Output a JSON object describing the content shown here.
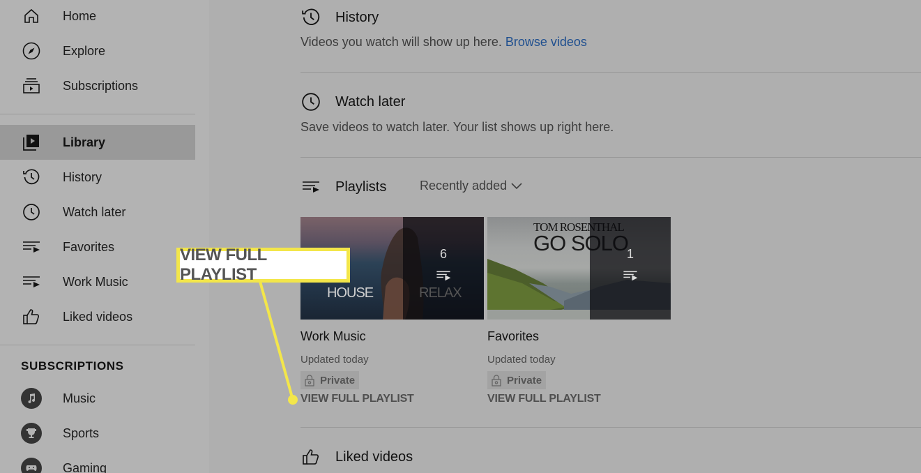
{
  "sidebar": {
    "nav": [
      {
        "label": "Home",
        "icon": "home-icon"
      },
      {
        "label": "Explore",
        "icon": "compass-icon"
      },
      {
        "label": "Subscriptions",
        "icon": "subscriptions-icon"
      }
    ],
    "library": [
      {
        "label": "Library",
        "icon": "library-icon",
        "active": true
      },
      {
        "label": "History",
        "icon": "history-icon"
      },
      {
        "label": "Watch later",
        "icon": "clock-icon"
      },
      {
        "label": "Favorites",
        "icon": "playlist-icon"
      },
      {
        "label": "Work Music",
        "icon": "playlist-icon"
      },
      {
        "label": "Liked videos",
        "icon": "thumbs-up-icon"
      }
    ],
    "subscriptions_heading": "SUBSCRIPTIONS",
    "subscriptions": [
      {
        "label": "Music",
        "icon": "music-note-icon"
      },
      {
        "label": "Sports",
        "icon": "trophy-icon"
      },
      {
        "label": "Gaming",
        "icon": "gamepad-icon"
      }
    ]
  },
  "main": {
    "history": {
      "title": "History",
      "description": "Videos you watch will show up here.",
      "link": "Browse videos"
    },
    "watch_later": {
      "title": "Watch later",
      "description": "Save videos to watch later. Your list shows up right here."
    },
    "playlists": {
      "title": "Playlists",
      "sort_label": "Recently added",
      "items": [
        {
          "title": "Work Music",
          "updated": "Updated today",
          "privacy": "Private",
          "count": "6",
          "view_label": "VIEW FULL PLAYLIST",
          "thumb_text_left": "HOUSE",
          "thumb_text_right": "RELAX"
        },
        {
          "title": "Favorites",
          "updated": "Updated today",
          "privacy": "Private",
          "count": "1",
          "view_label": "VIEW FULL PLAYLIST",
          "thumb_text_top": "TOM ROSENTHAL",
          "thumb_text_big": "GO SOLO"
        }
      ]
    },
    "liked_videos": {
      "title": "Liked videos"
    }
  },
  "callout": {
    "text": "VIEW FULL PLAYLIST",
    "color": "#f3e64a"
  },
  "colors": {
    "link": "#1f4f8f",
    "background": "#afafaf",
    "sidebar": "#b3b3b3",
    "active_item": "#999999"
  }
}
